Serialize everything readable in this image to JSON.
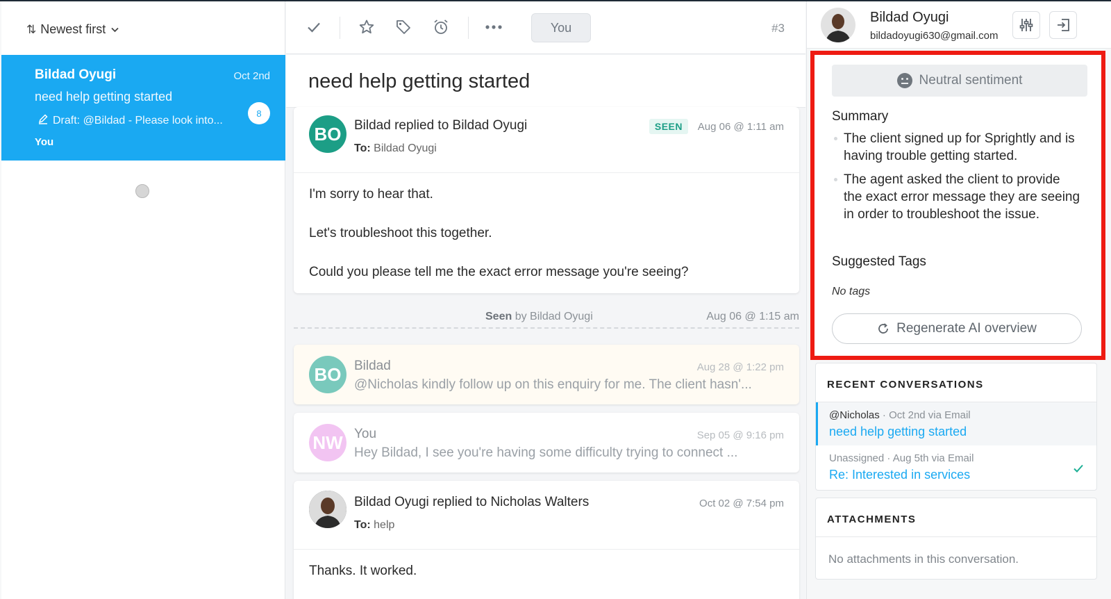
{
  "list": {
    "sort_label": "Newest first",
    "conversation": {
      "name": "Bildad Oyugi",
      "date": "Oct 2nd",
      "subject": "need help getting started",
      "draft": "Draft: @Bildad - Please look into...",
      "count": "8",
      "owner": "You"
    }
  },
  "toolbar": {
    "assign_label": "You",
    "ticket_number": "#3"
  },
  "thread": {
    "subject": "need help getting started",
    "messages": [
      {
        "initials": "BO",
        "title": "Bildad replied to Bildad Oyugi",
        "badge": "SEEN",
        "date": "Aug 06 @ 1:11 am",
        "to_label": "To:",
        "to_value": "Bildad Oyugi",
        "body": [
          "I'm sorry to hear that.",
          "Let's troubleshoot this together.",
          "Could you please tell me the exact error message you're seeing?"
        ],
        "avatar_color": "#1c9e86"
      },
      {
        "initials": "BO",
        "title": "Bildad",
        "date": "Aug 28 @ 1:22 pm",
        "preview": "@Nicholas kindly follow up on this enquiry for me. The client hasn'...",
        "avatar_color": "#79c9bc"
      },
      {
        "initials": "NW",
        "title": "You",
        "date": "Sep 05 @ 9:16 pm",
        "preview": "Hey Bildad,   I see you're having some difficulty trying to connect ...",
        "avatar_color": "#f2c4f2"
      },
      {
        "title": "Bildad Oyugi replied to Nicholas Walters",
        "date": "Oct 02 @ 7:54 pm",
        "to_label": "To:",
        "to_value": "help",
        "body": [
          "Thanks. It worked."
        ]
      }
    ],
    "seen_row": {
      "seen_word": "Seen",
      "by_text": " by Bildad Oyugi",
      "date": "Aug 06 @ 1:15 am"
    }
  },
  "contact": {
    "name": "Bildad Oyugi",
    "email": "bildadoyugi630@gmail.com"
  },
  "ai_overview": {
    "sentiment": "Neutral sentiment",
    "summary_title": "Summary",
    "summary": [
      "The client signed up for Sprightly and is having trouble getting started.",
      "The agent asked the client to provide the exact error message they are seeing in order to troubleshoot the issue."
    ],
    "tags_title": "Suggested Tags",
    "tags_empty": "No tags",
    "regenerate_label": "Regenerate AI overview"
  },
  "recent_conversations": {
    "title": "RECENT CONVERSATIONS",
    "items": [
      {
        "owner": "@Nicholas",
        "meta": " · Oct 2nd via Email",
        "subject": "need help getting started"
      },
      {
        "owner": "Unassigned",
        "meta": " · Aug 5th via Email",
        "subject": "Re: Interested in services"
      }
    ]
  },
  "attachments": {
    "title": "ATTACHMENTS",
    "empty": "No attachments in this conversation."
  },
  "colors": {
    "accent": "#1aa9f2",
    "highlight_border": "#ee1b12",
    "seen_badge": "#1c9e86"
  }
}
